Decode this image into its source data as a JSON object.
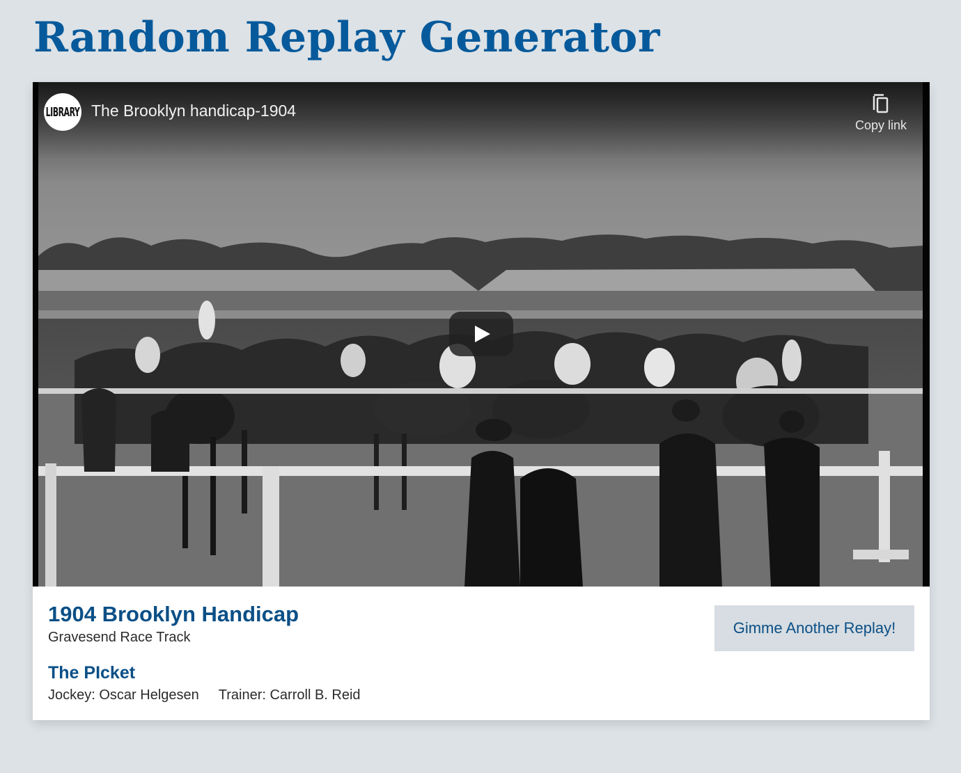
{
  "page": {
    "title": "Random Replay Generator"
  },
  "video": {
    "channel_logo_text": "LIBRARY",
    "title": "The Brooklyn handicap-1904",
    "copy_link_label": "Copy link"
  },
  "race": {
    "name": "1904 Brooklyn Handicap",
    "track": "Gravesend Race Track"
  },
  "winner": {
    "horse": "The PIcket",
    "jockey": "Jockey: Oscar Helgesen",
    "trainer": "Trainer: Carroll B. Reid"
  },
  "actions": {
    "replay_label": "Gimme Another Replay!"
  },
  "colors": {
    "accent": "#065a9b",
    "text_blue": "#0b4f86",
    "background": "#dde2e6",
    "button_bg": "#d7dde2"
  },
  "icons": {
    "copy": "copy-icon",
    "play": "play-icon"
  }
}
